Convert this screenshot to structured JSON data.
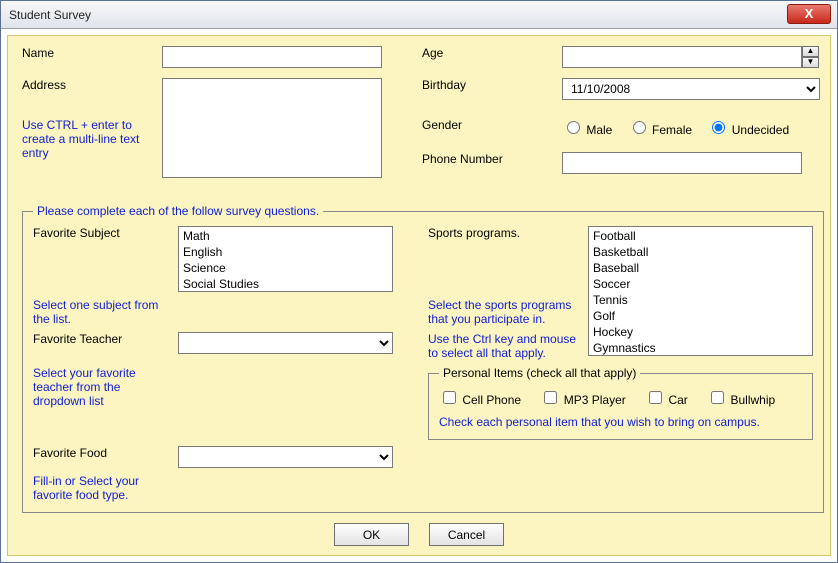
{
  "title": "Student Survey",
  "top": {
    "name_label": "Name",
    "name_value": "",
    "address_label": "Address",
    "address_value": "",
    "address_hint": "Use CTRL + enter to create a multi-line text entry",
    "age_label": "Age",
    "age_value": "",
    "birthday_label": "Birthday",
    "birthday_value": "11/10/2008",
    "gender_label": "Gender",
    "gender_options": {
      "male": "Male",
      "female": "Female",
      "undecided": "Undecided"
    },
    "gender_selected": "undecided",
    "phone_label": "Phone Number",
    "phone_value": ""
  },
  "survey": {
    "legend": "Please complete each of the follow survey questions.",
    "fav_subject_label": "Favorite Subject",
    "fav_subject_hint": "Select one subject from the list.",
    "subjects": [
      "Math",
      "English",
      "Science",
      "Social Studies"
    ],
    "fav_teacher_label": "Favorite Teacher",
    "fav_teacher_hint": "Select your favorite teacher from the dropdown list",
    "fav_teacher_value": "",
    "fav_food_label": "Favorite Food",
    "fav_food_hint": "Fill-in or Select your favorite food type.",
    "fav_food_value": "",
    "sports_label": "Sports programs.",
    "sports_hint1": "Select the sports programs that you participate in.",
    "sports_hint2": "Use the Ctrl key and mouse to select all that apply.",
    "sports": [
      "Football",
      "Basketball",
      "Baseball",
      "Soccer",
      "Tennis",
      "Golf",
      "Hockey",
      "Gymnastics"
    ],
    "personal_legend": "Personal Items (check all that apply)",
    "personal_items": {
      "cell": "Cell Phone",
      "mp3": "MP3 Player",
      "car": "Car",
      "bullwhip": "Bullwhip"
    },
    "personal_hint": "Check each personal item that you wish to bring on campus."
  },
  "buttons": {
    "ok": "OK",
    "cancel": "Cancel"
  }
}
